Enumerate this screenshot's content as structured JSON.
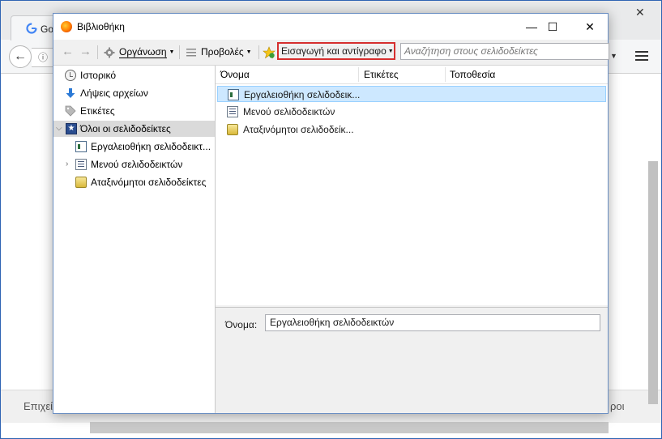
{
  "browser": {
    "tab_title": "Go",
    "content_left_text": "Επιχεί",
    "content_right_text": "ροι"
  },
  "library": {
    "title": "Βιβλιοθήκη",
    "window_buttons": {
      "minimize": "—",
      "maximize": "☐",
      "close": "✕"
    },
    "toolbar": {
      "back": "←",
      "forward": "→",
      "organize": "Οργάνωση",
      "views": "Προβολές",
      "import": "Εισαγωγή και αντίγραφο",
      "search_placeholder": "Αναζήτηση στους σελιδοδείκτες"
    },
    "sidebar": {
      "items": [
        {
          "label": "Ιστορικό",
          "icon": "history-icon"
        },
        {
          "label": "Λήψεις αρχείων",
          "icon": "download-arrow-icon"
        },
        {
          "label": "Ετικέτες",
          "icon": "tag-icon"
        },
        {
          "label": "Όλοι οι σελιδοδείκτες",
          "icon": "star-bookmarks-icon",
          "selected": true,
          "expanded": true
        },
        {
          "label": "Εργαλειοθήκη σελιδοδεικτ...",
          "icon": "bookmarks-toolbar-icon"
        },
        {
          "label": "Μενού σελιδοδεικτών",
          "icon": "bookmarks-menu-icon",
          "collapsed": true
        },
        {
          "label": "Αταξινόμητοι σελιδοδείκτες",
          "icon": "unsorted-bookmarks-icon"
        }
      ]
    },
    "columns": {
      "name": "Όνομα",
      "tags": "Ετικέτες",
      "location": "Τοποθεσία"
    },
    "rows": [
      {
        "name": "Εργαλειοθήκη σελιδοδεικ...",
        "icon": "bookmarks-toolbar-icon",
        "selected": true
      },
      {
        "name": "Μενού σελιδοδεικτών",
        "icon": "bookmarks-menu-icon"
      },
      {
        "name": "Αταξινόμητοι σελιδοδείκ...",
        "icon": "unsorted-bookmarks-icon"
      }
    ],
    "details": {
      "name_label": "Όνομα:",
      "name_value": "Εργαλειοθήκη σελιδοδεικτών"
    }
  },
  "colors": {
    "highlight_box": "#d62e2e",
    "selection": "#cde8ff",
    "window_border": "#2f64b3"
  }
}
